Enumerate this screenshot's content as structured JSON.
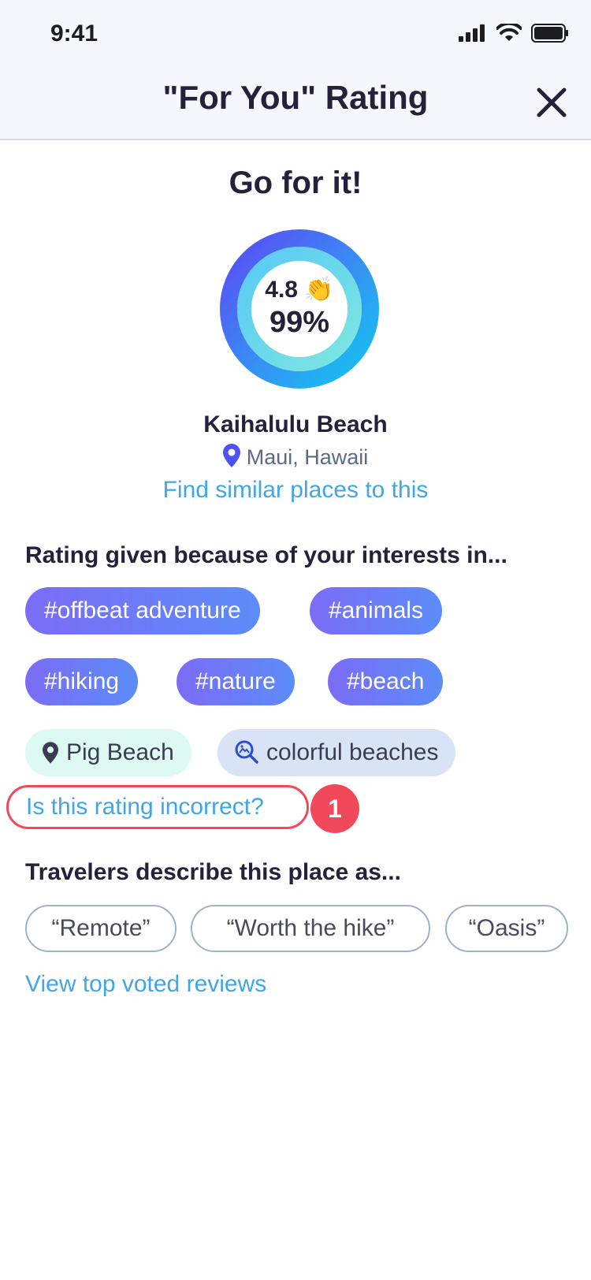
{
  "status_bar": {
    "time": "9:41"
  },
  "header": {
    "title": "\"For You\" Rating"
  },
  "rating": {
    "headline": "Go for it!",
    "score": "4.8",
    "percent": "99%",
    "percent_value": 99
  },
  "place": {
    "name": "Kaihalulu Beach",
    "location": "Maui, Hawaii",
    "similar_link": "Find similar places to this"
  },
  "interests": {
    "title": "Rating given because of your interests in...",
    "tags": [
      "#offbeat adventure",
      "#animals",
      "#hiking",
      "#nature",
      "#beach"
    ],
    "place_chip": "Pig Beach",
    "search_chip": "colorful beaches"
  },
  "feedback": {
    "incorrect_link": "Is this rating incorrect?",
    "badge": "1"
  },
  "travelers": {
    "title": "Travelers describe this place as...",
    "quotes": [
      "“Remote”",
      "“Worth the hike”",
      "“Oasis”"
    ],
    "reviews_link": "View top voted reviews"
  },
  "colors": {
    "accent_blue": "#40a6e6",
    "tag_gradient_start": "#7b6cf6",
    "tag_gradient_end": "#5c8cf8",
    "badge_red": "#f2495a",
    "text_dark": "#24213a"
  }
}
